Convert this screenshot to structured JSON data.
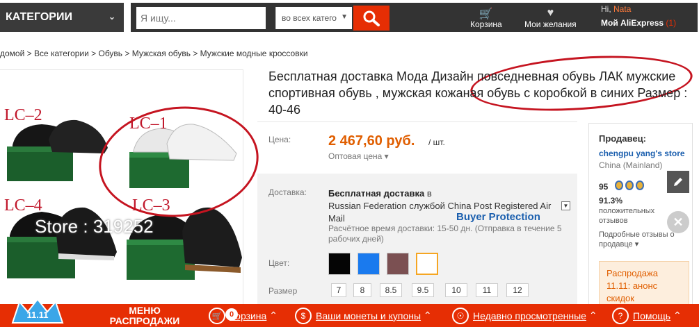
{
  "header": {
    "categories_label": "КАТЕГОРИИ",
    "search_placeholder": "Я ищу...",
    "search_scope": "во всех катего",
    "cart_label": "Корзина",
    "wishlist_label": "Мои желания",
    "greeting": "Hi,",
    "user_name": "Nata",
    "account_label": "Мой AliExpress",
    "account_count": "(1)"
  },
  "breadcrumb": "домой > Все категории > Обувь > Мужская обувь > Мужские модные кроссовки",
  "gallery": {
    "labels": [
      "LC–2",
      "LC–1",
      "LC–4",
      "LC–3"
    ],
    "watermark": "Store : 319252"
  },
  "product": {
    "title": "Бесплатная доставка Мода Дизайн повседневная обувь ЛАК мужские спортивная обувь , мужская кожаная обувь с коробкой в синих Размер : 40-46",
    "price_label": "Цена:",
    "price": "2 467,60 руб.",
    "price_unit": "/ шт.",
    "wholesale": "Оптовая цена",
    "delivery_label": "Доставка:",
    "delivery_free": "Бесплатная доставка",
    "delivery_in": "в",
    "delivery_rest": "Russian Federation службой China Post Registered Air Mail",
    "delivery_note": "Расчётное время доставки: 15-50 дн. (Отправка в течение 5 рабочих дней)",
    "buyer_protection": "Buyer Protection",
    "color_label": "Цвет:",
    "colors": [
      "#050505",
      "#1a7aee",
      "#7b5052",
      "#ffffff"
    ],
    "size_label": "Размер",
    "sizes": [
      "7",
      "8",
      "8.5",
      "9.5",
      "10",
      "11",
      "12"
    ]
  },
  "seller": {
    "title": "Продавец:",
    "store": "chengpu yang's store",
    "location": "China (Mainland)",
    "score": "95",
    "positive_pct": "91.3%",
    "positive_label": "положительных отзывов",
    "more_reviews": "Подробные отзывы о продавце",
    "promo": "Распродажа 11.11: анонс скидок"
  },
  "bottombar": {
    "badge_text": "11.11",
    "menu_label": "МЕНЮ РАСПРОДАЖИ",
    "cart_label": "Корзина",
    "cart_count": "0",
    "coins_label": "Ваши монеты и купоны",
    "recent_label": "Недавно просмотренные",
    "help_label": "Помощь"
  }
}
